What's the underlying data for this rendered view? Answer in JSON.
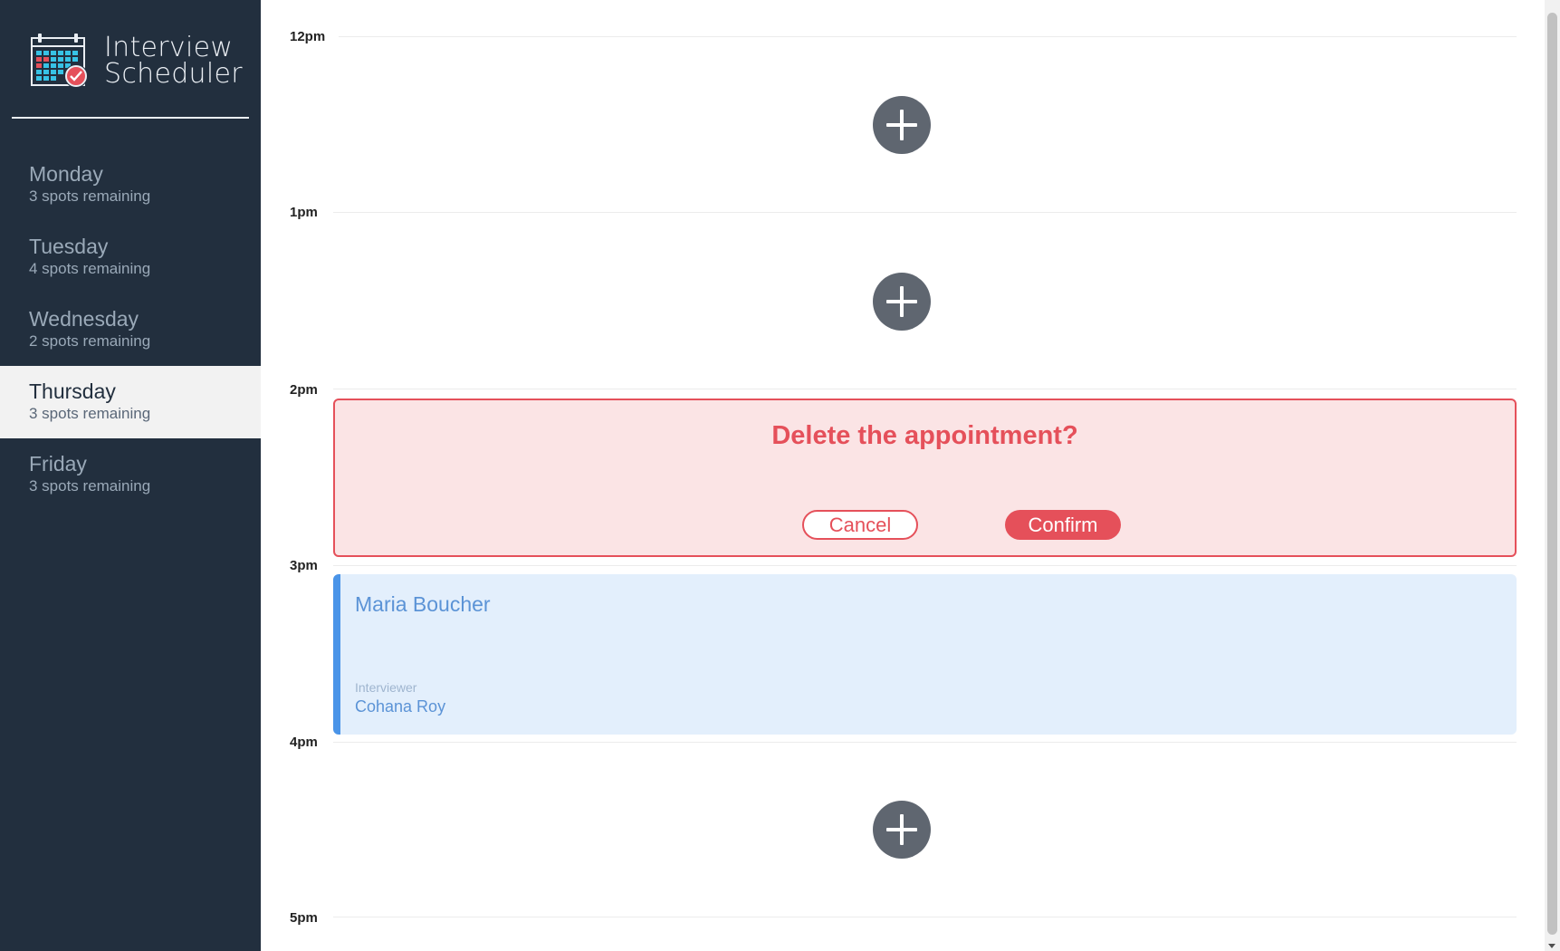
{
  "app": {
    "title_line1": "Interview",
    "title_line2": "Scheduler"
  },
  "sidebar": {
    "days": [
      {
        "name": "Monday",
        "spots": "3 spots remaining",
        "selected": false
      },
      {
        "name": "Tuesday",
        "spots": "4 spots remaining",
        "selected": false
      },
      {
        "name": "Wednesday",
        "spots": "2 spots remaining",
        "selected": false
      },
      {
        "name": "Thursday",
        "spots": "3 spots remaining",
        "selected": true
      },
      {
        "name": "Friday",
        "spots": "3 spots remaining",
        "selected": false
      }
    ]
  },
  "schedule": {
    "times": [
      "12pm",
      "1pm",
      "2pm",
      "3pm",
      "4pm",
      "5pm"
    ],
    "confirm": {
      "message": "Delete the appointment?",
      "cancel_label": "Cancel",
      "confirm_label": "Confirm"
    },
    "appointment": {
      "student": "Maria Boucher",
      "interviewer_label": "Interviewer",
      "interviewer": "Cohana Roy"
    }
  },
  "colors": {
    "sidebar_bg": "#222f3e",
    "danger": "#e5505a",
    "danger_bg": "#fbe4e5",
    "accent": "#4a94e8",
    "appointment_bg": "#e3effc",
    "add_button": "#5f6670"
  },
  "icons": {
    "brand": "calendar-check-icon",
    "add": "plus-icon"
  }
}
